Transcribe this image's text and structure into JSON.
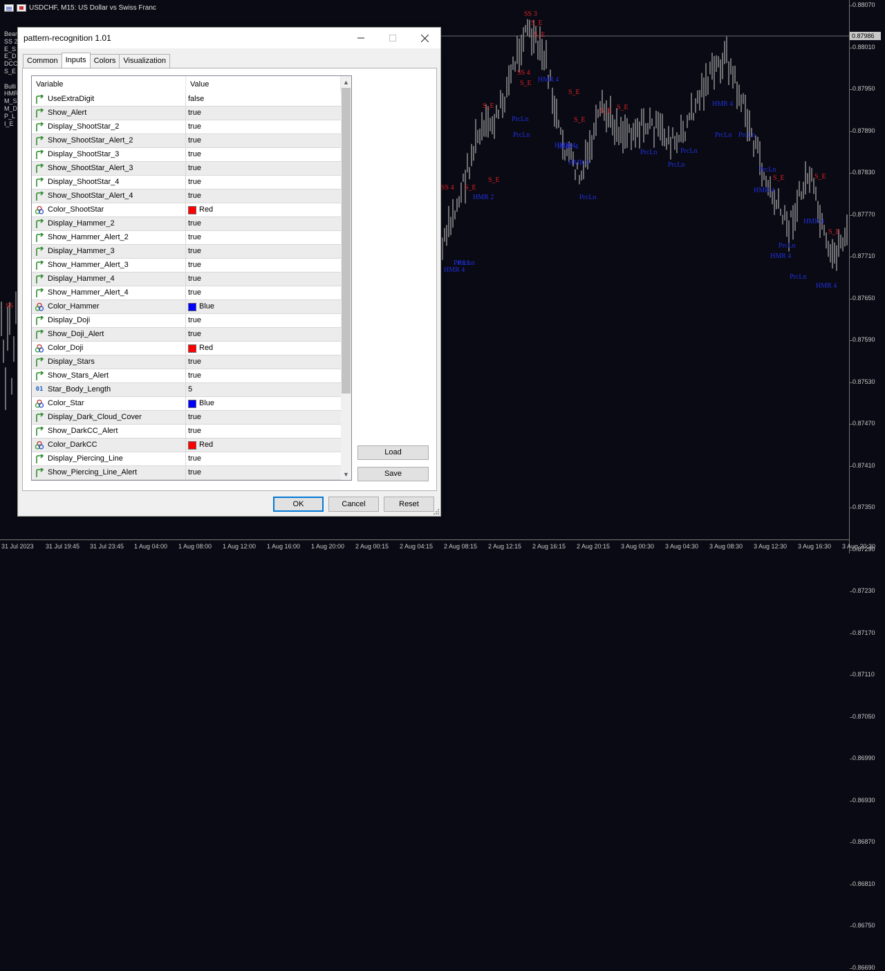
{
  "chart": {
    "symbol_title": "USDCHF, M15:  US Dollar vs Swiss Franc",
    "current_price": "0.87986",
    "price_labels": [
      "0.88070",
      "0.88010",
      "0.87950",
      "0.87890",
      "0.87830",
      "0.87770",
      "0.87710",
      "0.87650",
      "0.87590",
      "0.87530",
      "0.87470",
      "0.87410",
      "0.87350",
      "0.87290",
      "0.87230",
      "0.87170",
      "0.87110",
      "0.87050",
      "0.86990",
      "0.86930",
      "0.86870",
      "0.86810",
      "0.86750",
      "0.86690"
    ],
    "time_labels": [
      "31 Jul 2023",
      "31 Jul 19:45",
      "31 Jul 23:45",
      "1 Aug 04:00",
      "1 Aug 08:00",
      "1 Aug 12:00",
      "1 Aug 16:00",
      "1 Aug 20:00",
      "2 Aug 00:15",
      "2 Aug 04:15",
      "2 Aug 08:15",
      "2 Aug 12:15",
      "2 Aug 16:15",
      "2 Aug 20:15",
      "3 Aug 00:30",
      "3 Aug 04:30",
      "3 Aug 08:30",
      "3 Aug 12:30",
      "3 Aug 16:30",
      "3 Aug 20:30"
    ],
    "legend_lines": [
      "Bear",
      "SS 2",
      "E_S",
      "E_D",
      "DCC",
      "S_E",
      "",
      "Bulli",
      "HMR",
      "M_S",
      "M_D",
      "P_L",
      "I_E"
    ],
    "markers": [
      {
        "text": "SS 3",
        "color": "red"
      },
      {
        "text": "S_E",
        "color": "red"
      },
      {
        "text": "S_E",
        "color": "red"
      },
      {
        "text": "SS 4",
        "color": "red"
      },
      {
        "text": "S_E",
        "color": "red"
      },
      {
        "text": "HMR 4",
        "color": "blue"
      },
      {
        "text": "S_E",
        "color": "red"
      },
      {
        "text": "S_E",
        "color": "red"
      },
      {
        "text": "PrcLn",
        "color": "blue"
      },
      {
        "text": "PrcLn",
        "color": "blue"
      },
      {
        "text": "S_E",
        "color": "red"
      },
      {
        "text": "S_E",
        "color": "red"
      },
      {
        "text": "S_E",
        "color": "red"
      },
      {
        "text": "HMR 4",
        "color": "blue"
      },
      {
        "text": "HMR 4",
        "color": "blue"
      },
      {
        "text": "HMR 4",
        "color": "blue"
      },
      {
        "text": "PrcLn",
        "color": "blue"
      },
      {
        "text": "PrcLn",
        "color": "blue"
      },
      {
        "text": "PrcLn",
        "color": "blue"
      },
      {
        "text": "PrcLn",
        "color": "blue"
      },
      {
        "text": "PrcLn",
        "color": "blue"
      },
      {
        "text": "SS 4",
        "color": "red"
      },
      {
        "text": "S_E",
        "color": "red"
      },
      {
        "text": "S_E",
        "color": "red"
      },
      {
        "text": "HMR 2",
        "color": "blue"
      },
      {
        "text": "PrcLn",
        "color": "blue"
      },
      {
        "text": "PrcLn",
        "color": "blue"
      },
      {
        "text": "HMR 4",
        "color": "blue"
      },
      {
        "text": "HMR 4",
        "color": "blue"
      },
      {
        "text": "PrcLn",
        "color": "blue"
      },
      {
        "text": "HMR 4",
        "color": "blue"
      },
      {
        "text": "PrcLn",
        "color": "blue"
      },
      {
        "text": "PrcLn",
        "color": "blue"
      },
      {
        "text": "PrcLn",
        "color": "blue"
      },
      {
        "text": "HMR 4",
        "color": "blue"
      },
      {
        "text": "HMR 4",
        "color": "blue"
      },
      {
        "text": "S_E",
        "color": "red"
      },
      {
        "text": "S_E",
        "color": "red"
      },
      {
        "text": "S_E",
        "color": "red"
      },
      {
        "text": "HMR 4",
        "color": "blue"
      },
      {
        "text": "SS",
        "color": "red"
      }
    ]
  },
  "dialog": {
    "title": "pattern-recognition 1.01",
    "tabs": [
      "Common",
      "Inputs",
      "Colors",
      "Visualization"
    ],
    "active_tab": "Inputs",
    "columns": {
      "variable": "Variable",
      "value": "Value"
    },
    "rows": [
      {
        "type": "bool",
        "name": "UseExtraDigit",
        "value": "false"
      },
      {
        "type": "bool",
        "name": "Show_Alert",
        "value": "true"
      },
      {
        "type": "bool",
        "name": "Display_ShootStar_2",
        "value": "true"
      },
      {
        "type": "bool",
        "name": "Show_ShootStar_Alert_2",
        "value": "true"
      },
      {
        "type": "bool",
        "name": "Display_ShootStar_3",
        "value": "true"
      },
      {
        "type": "bool",
        "name": "Show_ShootStar_Alert_3",
        "value": "true"
      },
      {
        "type": "bool",
        "name": "Display_ShootStar_4",
        "value": "true"
      },
      {
        "type": "bool",
        "name": "Show_ShootStar_Alert_4",
        "value": "true"
      },
      {
        "type": "color",
        "name": "Color_ShootStar",
        "value": "Red",
        "swatch": "#ff0000"
      },
      {
        "type": "bool",
        "name": "Display_Hammer_2",
        "value": "true"
      },
      {
        "type": "bool",
        "name": "Show_Hammer_Alert_2",
        "value": "true"
      },
      {
        "type": "bool",
        "name": "Display_Hammer_3",
        "value": "true"
      },
      {
        "type": "bool",
        "name": "Show_Hammer_Alert_3",
        "value": "true"
      },
      {
        "type": "bool",
        "name": "Display_Hammer_4",
        "value": "true"
      },
      {
        "type": "bool",
        "name": "Show_Hammer_Alert_4",
        "value": "true"
      },
      {
        "type": "color",
        "name": "Color_Hammer",
        "value": "Blue",
        "swatch": "#0000ff"
      },
      {
        "type": "bool",
        "name": "Display_Doji",
        "value": "true"
      },
      {
        "type": "bool",
        "name": "Show_Doji_Alert",
        "value": "true"
      },
      {
        "type": "color",
        "name": "Color_Doji",
        "value": "Red",
        "swatch": "#ff0000"
      },
      {
        "type": "bool",
        "name": "Display_Stars",
        "value": "true"
      },
      {
        "type": "bool",
        "name": "Show_Stars_Alert",
        "value": "true"
      },
      {
        "type": "int",
        "name": "Star_Body_Length",
        "value": "5"
      },
      {
        "type": "color",
        "name": "Color_Star",
        "value": "Blue",
        "swatch": "#0000ff"
      },
      {
        "type": "bool",
        "name": "Display_Dark_Cloud_Cover",
        "value": "true"
      },
      {
        "type": "bool",
        "name": "Show_DarkCC_Alert",
        "value": "true"
      },
      {
        "type": "color",
        "name": "Color_DarkCC",
        "value": "Red",
        "swatch": "#ff0000"
      },
      {
        "type": "bool",
        "name": "Display_Piercing_Line",
        "value": "true"
      },
      {
        "type": "bool",
        "name": "Show_Piercing_Line_Alert",
        "value": "true"
      }
    ],
    "side_buttons": {
      "load": "Load",
      "save": "Save"
    },
    "footer_buttons": {
      "ok": "OK",
      "cancel": "Cancel",
      "reset": "Reset"
    },
    "colors": {
      "accent": "#0078d7",
      "bool_icon": "#2e8b2e",
      "int_icon": "#2060c0"
    }
  }
}
